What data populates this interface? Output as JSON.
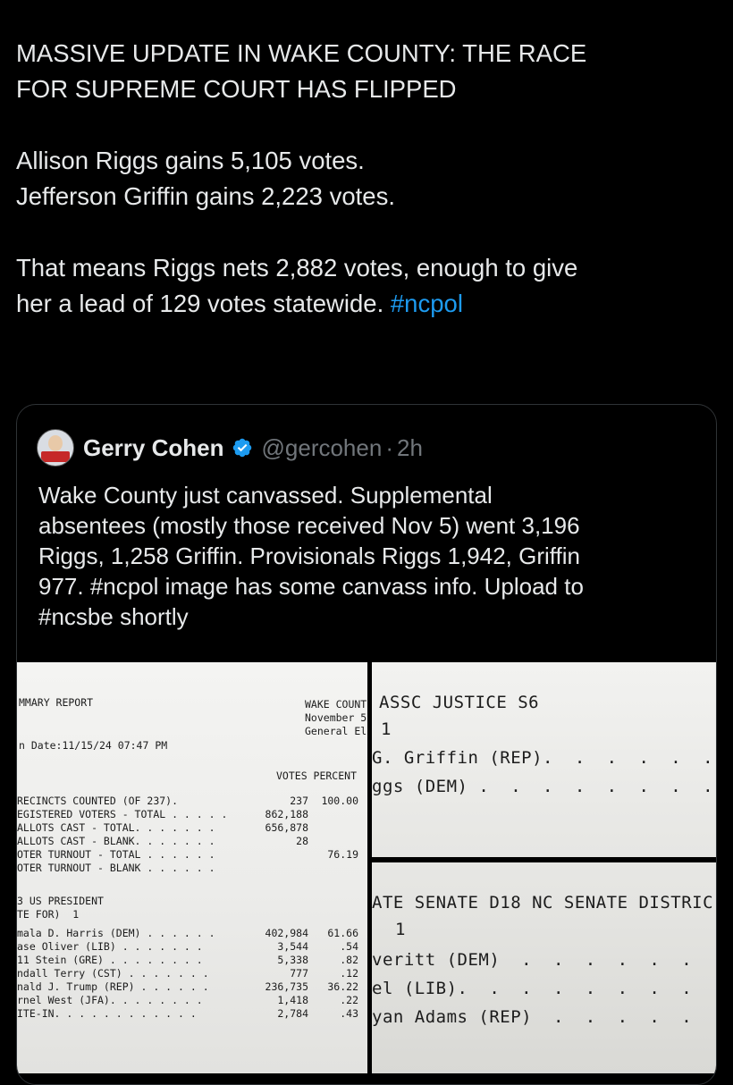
{
  "tweet": {
    "line1": "MASSIVE UPDATE IN WAKE COUNTY: THE RACE",
    "line2": "FOR SUPREME COURT HAS FLIPPED",
    "line3": "Allison Riggs gains 5,105 votes.",
    "line4": "Jefferson Griffin gains 2,223 votes.",
    "line5": "That means Riggs nets 2,882 votes, enough to give",
    "line6": "her a lead of 129 votes statewide.",
    "hashtag": "#ncpol"
  },
  "quote": {
    "author_name": "Gerry Cohen",
    "handle": "@gercohen",
    "separator": "·",
    "time": "2h",
    "avatar_icon": "profile-avatar",
    "verified_icon": "verified-badge-icon",
    "verified_color": "#1d9bf0",
    "body_lines": [
      "Wake County just canvassed. Supplemental",
      "absentees (mostly those received Nov 5) went 3,196",
      "Riggs, 1,258 Griffin. Provisionals Riggs 1,942, Griffin",
      "977. #ncpol image has some canvass info. Upload to",
      "#ncsbe shortly"
    ]
  },
  "doc_a": {
    "report_label": "MMARY REPORT",
    "county": "WAKE COUNT",
    "date_line": "November 5",
    "election": "General El",
    "run_date": "n Date:11/15/24 07:47 PM",
    "col_header": "VOTES PERCENT",
    "stats": [
      {
        "label": "RECINCTS COUNTED (OF 237).",
        "votes": "237",
        "pct": "100.00"
      },
      {
        "label": "EGISTERED VOTERS - TOTAL . . . . .",
        "votes": "862,188",
        "pct": ""
      },
      {
        "label": "ALLOTS CAST - TOTAL. . . . . . .",
        "votes": "656,878",
        "pct": ""
      },
      {
        "label": "ALLOTS CAST - BLANK. . . . . . .",
        "votes": "28",
        "pct": ""
      },
      {
        "label": "OTER TURNOUT - TOTAL . . . . . .",
        "votes": "",
        "pct": "76.19"
      },
      {
        "label": "OTER TURNOUT - BLANK . . . . . .",
        "votes": "",
        "pct": ""
      }
    ],
    "race_title": "3 US PRESIDENT",
    "race_vote_for": "TE FOR)  1",
    "candidates": [
      {
        "label": "mala D. Harris (DEM) . . . . . .",
        "votes": "402,984",
        "pct": "61.66"
      },
      {
        "label": "ase Oliver (LIB) . . . . . . .",
        "votes": "3,544",
        "pct": ".54"
      },
      {
        "label": "11 Stein (GRE) . . . . . . . .",
        "votes": "5,338",
        "pct": ".82"
      },
      {
        "label": "ndall Terry (CST) . . . . . . .",
        "votes": "777",
        "pct": ".12"
      },
      {
        "label": "nald J. Trump (REP) . . . . . .",
        "votes": "236,735",
        "pct": "36.22"
      },
      {
        "label": "rnel West (JFA). . . . . . . .",
        "votes": "1,418",
        "pct": ".22"
      },
      {
        "label": "ITE-IN. . . . . . . . . . . .",
        "votes": "2,784",
        "pct": ".43"
      }
    ]
  },
  "doc_b": {
    "title": "ASSC JUSTICE S6",
    "vote_for": "1",
    "line1": "G. Griffin (REP).  .  .  .  .  .",
    "line2": "ggs (DEM) .  .  .  .  .  .  .  ."
  },
  "doc_c": {
    "title": "ATE SENATE D18 NC SENATE DISTRIC",
    "vote_for": "1",
    "line1": "veritt (DEM)  .  .  .  .  .  .  .",
    "line2": "el (LIB).  .  .  .  .  .  .  .  .",
    "line3": "yan Adams (REP)  .  .  .  .  .  ."
  }
}
